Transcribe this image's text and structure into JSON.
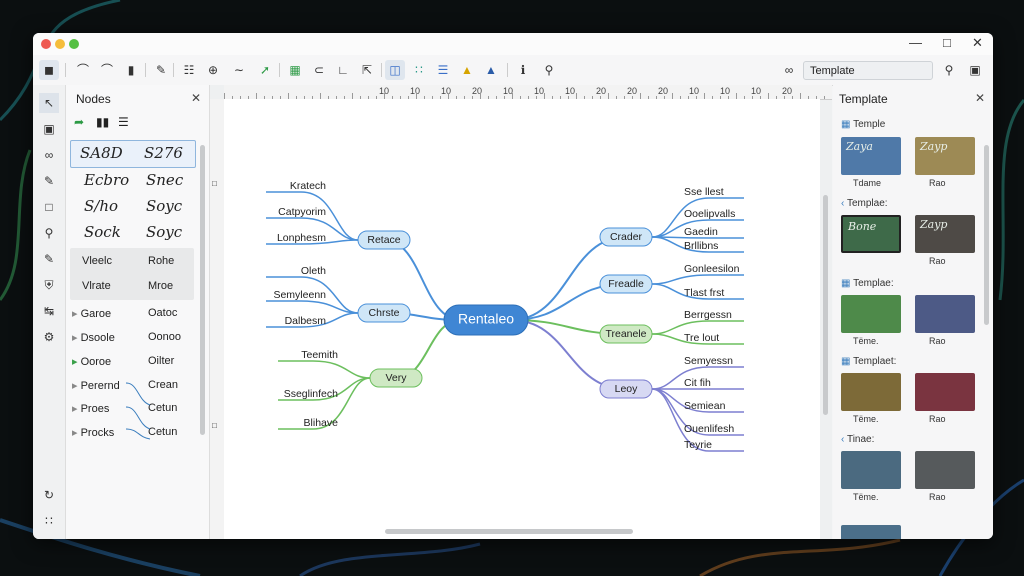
{
  "toolbar": {
    "template_label": "Template"
  },
  "nodes_panel": {
    "title": "Nodes",
    "fonts": [
      [
        "SA8D",
        "S276"
      ],
      [
        "Ecbro",
        "Snec"
      ],
      [
        "S/ho",
        "Soyc"
      ],
      [
        "Sock",
        "Soyc"
      ]
    ],
    "swatches": [
      [
        "Vleelc",
        "Rohe"
      ],
      [
        "Vlrate",
        "Mroe"
      ]
    ],
    "list": [
      [
        "Garoe",
        "Oatoc"
      ],
      [
        "Dsoole",
        "Oonoo"
      ],
      [
        "Ooroe",
        "Oilter"
      ],
      [
        "Perernd",
        "Crean"
      ],
      [
        "Proes",
        "Cetun"
      ],
      [
        "Procks",
        "Cetun"
      ]
    ]
  },
  "ruler": [
    "10",
    "10",
    "10",
    "20",
    "10",
    "10",
    "10",
    "20",
    "20",
    "20",
    "10",
    "10",
    "10",
    "20"
  ],
  "mindmap": {
    "central": "Rentaleo",
    "branches": [
      {
        "label": "Retace",
        "children": [
          "Kratech",
          "Catpyorim",
          "Lonphesm"
        ]
      },
      {
        "label": "Chrste",
        "children": [
          "Oleth",
          "Semyleenn",
          "Dalbesm"
        ]
      },
      {
        "label": "Very",
        "children": [
          "Teemith",
          "Sseglinfech",
          "Blihave"
        ]
      },
      {
        "label": "Crader",
        "children": [
          "Sse llest",
          "Ooelipvalls",
          "Gaedin",
          "Brllibns"
        ]
      },
      {
        "label": "Freadle",
        "children": [
          "Gonleesilon",
          "Tlast frst"
        ]
      },
      {
        "label": "Treanele",
        "children": [
          "Berrgessn",
          "Tre lout"
        ]
      },
      {
        "label": "Leoy",
        "children": [
          "Semyessn",
          "Cit fih",
          "Semiean",
          "Ouenlifesh",
          "Teyrie"
        ]
      }
    ]
  },
  "template_panel": {
    "title": "Template",
    "sections": [
      "Temple",
      "Templae:",
      "Templae:",
      "Templaet:",
      "Tinae:"
    ],
    "thumbs": [
      {
        "text": "Zaya",
        "caption": "Tdame",
        "color": "#4f79a8"
      },
      {
        "text": "Zayp",
        "caption": "Rao",
        "color": "#9d8a55"
      },
      {
        "text": "Bone",
        "caption": "",
        "color": "#3e6a49"
      },
      {
        "text": "Zayp",
        "caption": "Rao",
        "color": "#4e4a46"
      },
      {
        "text": "",
        "caption": "Tëme.",
        "color": "#4e8a4a"
      },
      {
        "text": "",
        "caption": "Rao",
        "color": "#4d5a86"
      },
      {
        "text": "",
        "caption": "Tëme.",
        "color": "#7d6a38"
      },
      {
        "text": "",
        "caption": "Rao",
        "color": "#7a3440"
      },
      {
        "text": "",
        "caption": "Tëme.",
        "color": "#4b6a80"
      },
      {
        "text": "",
        "caption": "Rao",
        "color": "#565a5c"
      },
      {
        "text": "",
        "caption": "",
        "color": "#4b6f8a"
      }
    ]
  },
  "colors": {
    "blue": "#4a90d9",
    "green": "#6cbf5e",
    "purple": "#7d7fd0",
    "central": "#3f86d4"
  }
}
